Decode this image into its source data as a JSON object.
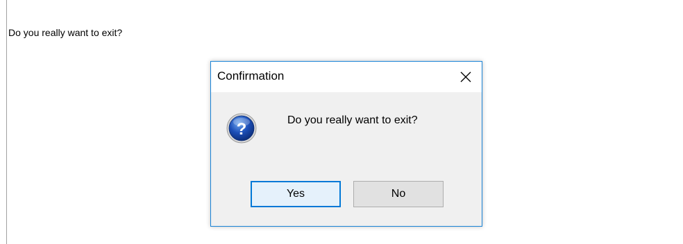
{
  "background": {
    "text": "Do you really want to exit?"
  },
  "dialog": {
    "title": "Confirmation",
    "message": "Do you really want to exit?",
    "icon": "question-icon",
    "close_icon": "close-icon",
    "accent_color": "#0078d7",
    "buttons": {
      "yes_label": "Yes",
      "no_label": "No"
    }
  }
}
